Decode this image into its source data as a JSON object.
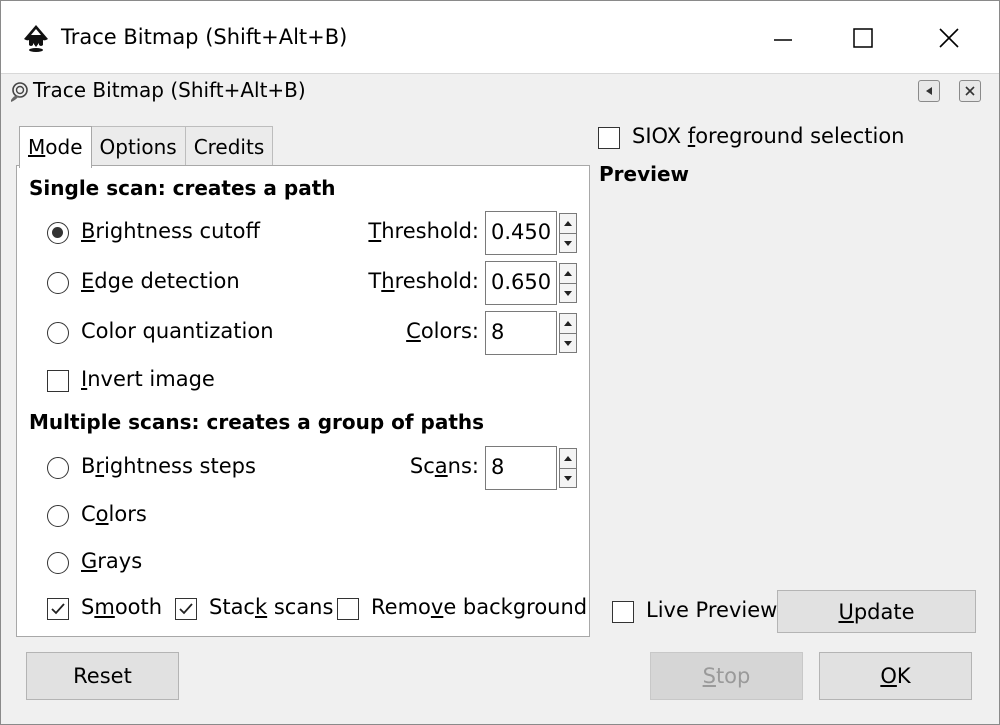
{
  "window": {
    "title": "Trace Bitmap (Shift+Alt+B)",
    "controls": {
      "minimize": "minimize-icon",
      "maximize": "maximize-icon",
      "close": "close-icon"
    }
  },
  "dock": {
    "title": "Trace Bitmap (Shift+Alt+B)"
  },
  "tabs": [
    {
      "acc": "M",
      "rest": "ode",
      "active": true
    },
    {
      "label": "Options"
    },
    {
      "label": "Credits"
    }
  ],
  "single_scan": {
    "title": "Single scan: creates a path",
    "brightness": {
      "acc": "B",
      "rest": "rightness cutoff",
      "selected": true,
      "field_acc": "T",
      "field_rest": "hreshold:",
      "value": "0.450"
    },
    "edge": {
      "acc": "E",
      "rest": "dge detection",
      "selected": false,
      "field_pre": "T",
      "field_acc": "h",
      "field_rest": "reshold:",
      "value": "0.650"
    },
    "quant": {
      "label": "Color quantization",
      "selected": false,
      "field_acc": "C",
      "field_rest": "olors:",
      "value": "8"
    },
    "invert": {
      "acc": "I",
      "rest": "nvert image",
      "checked": false
    }
  },
  "multi_scan": {
    "title": "Multiple scans: creates a group of paths",
    "brightness_steps": {
      "pre": "B",
      "acc": "r",
      "rest": "ightness steps",
      "selected": false,
      "field_pre": "Sc",
      "field_acc": "a",
      "field_rest": "ns:",
      "value": "8"
    },
    "colors": {
      "pre": "C",
      "acc": "o",
      "rest": "lors",
      "selected": false
    },
    "grays": {
      "acc": "G",
      "rest": "rays",
      "selected": false
    },
    "smooth": {
      "pre": "S",
      "acc": "m",
      "rest": "ooth",
      "checked": true
    },
    "stack": {
      "pre": "Stac",
      "acc": "k",
      "rest": " scans",
      "checked": true
    },
    "remove_bg": {
      "pre": "Remo",
      "acc": "v",
      "rest": "e background",
      "checked": false
    }
  },
  "right": {
    "siox": {
      "pre": "SIOX ",
      "acc": "f",
      "rest": "oreground selection",
      "checked": false
    },
    "preview_title": "Preview",
    "live_preview": {
      "label": "Live Preview",
      "checked": false
    },
    "update": {
      "acc": "U",
      "rest": "pdate"
    }
  },
  "buttons": {
    "reset": "Reset",
    "stop": {
      "acc": "S",
      "rest": "top",
      "enabled": false
    },
    "ok": {
      "acc": "O",
      "rest": "K"
    }
  }
}
